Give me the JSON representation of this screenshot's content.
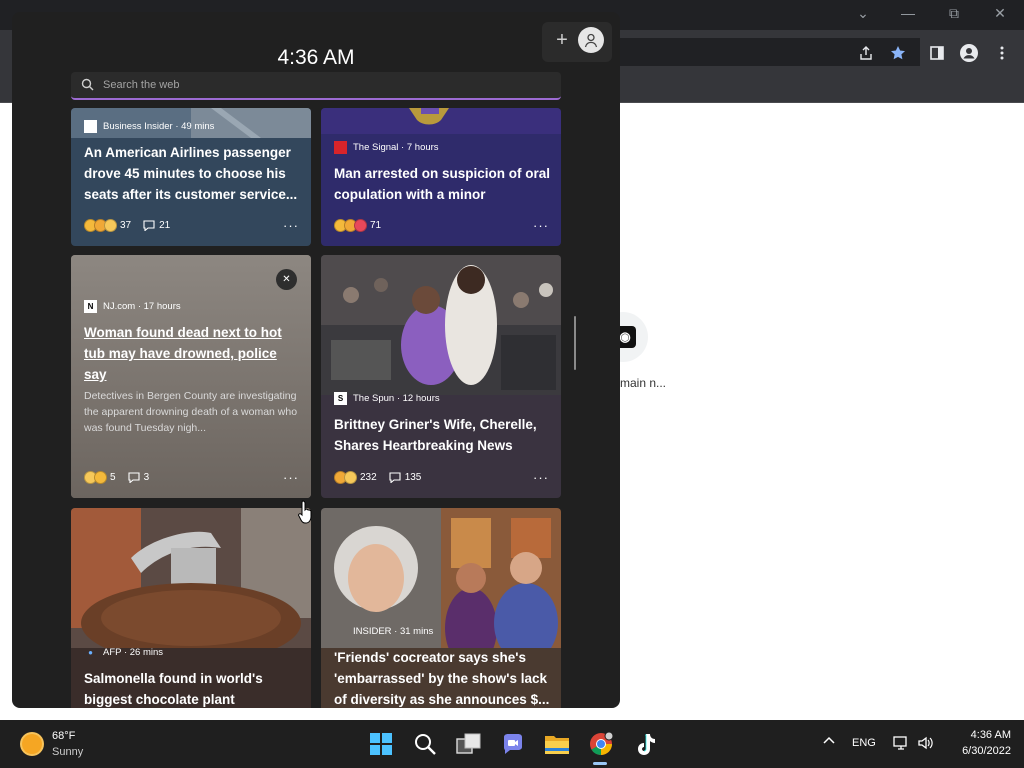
{
  "widgets": {
    "time": "4:36 AM",
    "search_placeholder": "Search the web",
    "cards": [
      {
        "source": "Business Insider · 49 mins",
        "headline": "An American Airlines passenger drove 45 minutes to choose his seats after its customer service...",
        "reaction_count": "37",
        "comment_count": "21"
      },
      {
        "source": "The Signal · 7 hours",
        "headline": "Man arrested on suspicion of oral copulation with a minor",
        "reaction_count": "71",
        "comment_count": ""
      },
      {
        "source": "NJ.com · 17 hours",
        "headline": "Woman found dead next to hot tub may have drowned, police say",
        "summary": "Detectives in Bergen County are investigating the apparent drowning death of a woman who was found Tuesday nigh...",
        "reaction_count": "5",
        "comment_count": "3"
      },
      {
        "source": "The Spun · 12 hours",
        "headline": "Brittney Griner's Wife, Cherelle, Shares Heartbreaking News",
        "reaction_count": "232",
        "comment_count": "135"
      },
      {
        "source": "AFP · 26 mins",
        "headline": "Salmonella found in world's biggest chocolate plant"
      },
      {
        "source": "INSIDER · 31 mins",
        "headline": "'Friends' cocreator says she's 'embarrassed' by the show's lack of diversity as she announces $..."
      }
    ]
  },
  "browser": {
    "shortcut_label": "main n..."
  },
  "taskbar": {
    "temperature": "68°F",
    "condition": "Sunny",
    "language": "ENG",
    "time": "4:36 AM",
    "date": "6/30/2022"
  },
  "icons": {
    "card_source_logos": [
      "business-insider-logo",
      "the-signal-logo",
      "njcom-logo",
      "the-spun-logo",
      "afp-logo",
      "insider-logo"
    ],
    "taskbar_apps": [
      "windows-start-icon",
      "search-icon",
      "task-view-icon",
      "teams-chat-icon",
      "file-explorer-icon",
      "chrome-icon",
      "tiktok-icon"
    ]
  },
  "colors": {
    "panel_bg": "#202020",
    "search_accent": "#9d6bd3",
    "card1_bg": "#33475c",
    "card2_bg": "#2f2b6b",
    "card3_bg": "#7d7670",
    "card4_bg": "#3a3340",
    "taskbar_bg": "#1f1f1f"
  }
}
